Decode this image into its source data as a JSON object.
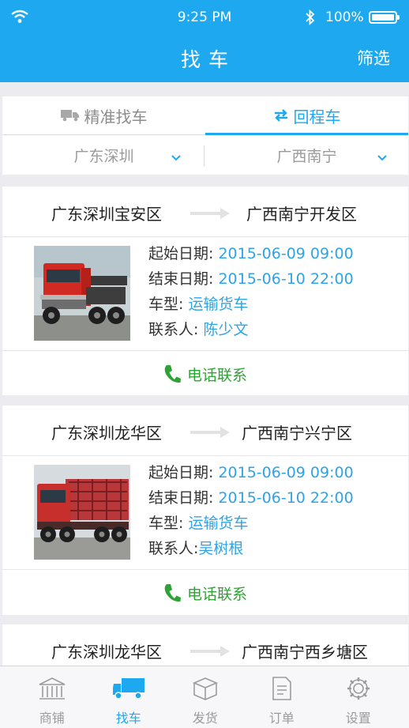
{
  "status": {
    "time": "9:25 PM",
    "battery": "100%"
  },
  "nav": {
    "title": "找车",
    "filter": "筛选"
  },
  "tabs": [
    {
      "label": "精准找车"
    },
    {
      "label": "回程车"
    }
  ],
  "filters": {
    "origin": "广东深圳",
    "destination": "广西南宁"
  },
  "labels": {
    "start": "起始日期: ",
    "end": "结束日期: ",
    "type": "车型: ",
    "contact": "联系人: ",
    "contact_alt": "联系人:",
    "call": "电话联系"
  },
  "listings": [
    {
      "from": "广东深圳宝安区",
      "to": "广西南宁开发区",
      "start_date": "2015-06-09  09:00",
      "end_date": "2015-06-10  22:00",
      "truck_type": "运输货车",
      "contact": "陈少文"
    },
    {
      "from": "广东深圳龙华区",
      "to": "广西南宁兴宁区",
      "start_date": "2015-06-09  09:00",
      "end_date": "2015-06-10  22:00",
      "truck_type": "运输货车",
      "contact": "吴树根"
    },
    {
      "from": "广东深圳龙华区",
      "to": "广西南宁西乡塘区"
    }
  ],
  "tabbar": [
    {
      "label": "商铺"
    },
    {
      "label": "找车"
    },
    {
      "label": "发货"
    },
    {
      "label": "订单"
    },
    {
      "label": "设置"
    }
  ],
  "colors": {
    "brand": "#1ea8ef",
    "call": "#2fa236",
    "value": "#2ea4e6"
  }
}
